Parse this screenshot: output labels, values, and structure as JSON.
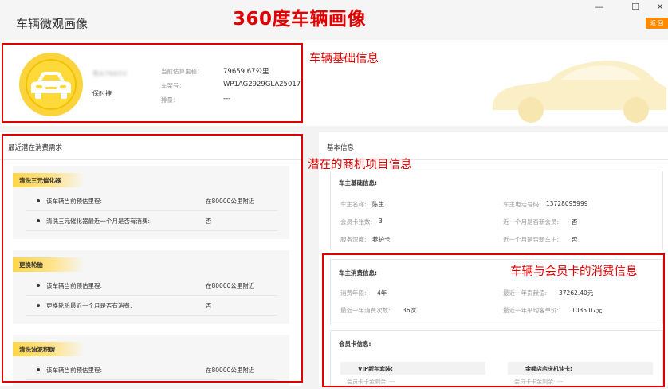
{
  "header": {
    "app_title": "车辆微观画像",
    "big_title": "360度车辆画像",
    "back_label": "返 回",
    "window_controls": [
      "—",
      "☐",
      "✕"
    ]
  },
  "vehicle": {
    "plate": "粤A7N65V",
    "brand": "保时捷",
    "fields": [
      {
        "label": "当前估算里程：",
        "value": "79659.67公里"
      },
      {
        "label": "车架号：",
        "value": "WP1AG2929GLA25017"
      },
      {
        "label": "排量：",
        "value": "---"
      }
    ]
  },
  "annotations": {
    "basic": "车辆基础信息",
    "potential": "潜在的商机项目信息",
    "consumption": "车辆与会员卡的消费信息"
  },
  "demand": {
    "title": "最近潜在消费需求",
    "cards": [
      {
        "tag": "清洗三元催化器",
        "rows": [
          {
            "q": "该车辆当前预估里程:",
            "a": "在80000公里附近"
          },
          {
            "q": "清洗三元催化器最近一个月是否有消费:",
            "a": "否"
          }
        ]
      },
      {
        "tag": "更换轮胎",
        "rows": [
          {
            "q": "该车辆当前预估里程:",
            "a": "在80000公里附近"
          },
          {
            "q": "更换轮胎最近一个月是否有消费:",
            "a": "否"
          }
        ]
      },
      {
        "tag": "清洗油泥积碳",
        "rows": [
          {
            "q": "该车辆当前预估里程:",
            "a": "在80000公里附近"
          }
        ]
      }
    ]
  },
  "basic_info": {
    "title": "基本信息",
    "owner": {
      "head": "车主基础信息:",
      "left": [
        {
          "label": "车主名称:",
          "value": "陈生"
        },
        {
          "label": "会员卡张数:",
          "value": "3"
        },
        {
          "label": "服务深度:",
          "value": "养护卡"
        }
      ],
      "right": [
        {
          "label": "车主电话号码:",
          "value": "13728095999"
        },
        {
          "label": "近一个月是否新会员:",
          "value": "否"
        },
        {
          "label": "近一个月是否新车主:",
          "value": "否"
        }
      ]
    },
    "consumption": {
      "head": "车主消费信息:",
      "left": [
        {
          "label": "消费年限:",
          "value": "4年"
        },
        {
          "label": "最近一年消费次数:",
          "value": "36次"
        }
      ],
      "right": [
        {
          "label": "最近一年贡献值:",
          "value": "37262.40元"
        },
        {
          "label": "最近一年平均客单价:",
          "value": "1035.07元"
        }
      ]
    },
    "member": {
      "head": "会员卡信息:",
      "cards": [
        {
          "name": "VIP新年套装:",
          "row": "会员卡卡金剩余: ---"
        },
        {
          "name": "金额店店庆机油卡:",
          "row": "会员卡卡金剩余: ---"
        }
      ]
    }
  },
  "colors": {
    "annotation_red": "#e00000",
    "accent_yellow": "#fbd33d",
    "back_button": "#ff8a00"
  }
}
